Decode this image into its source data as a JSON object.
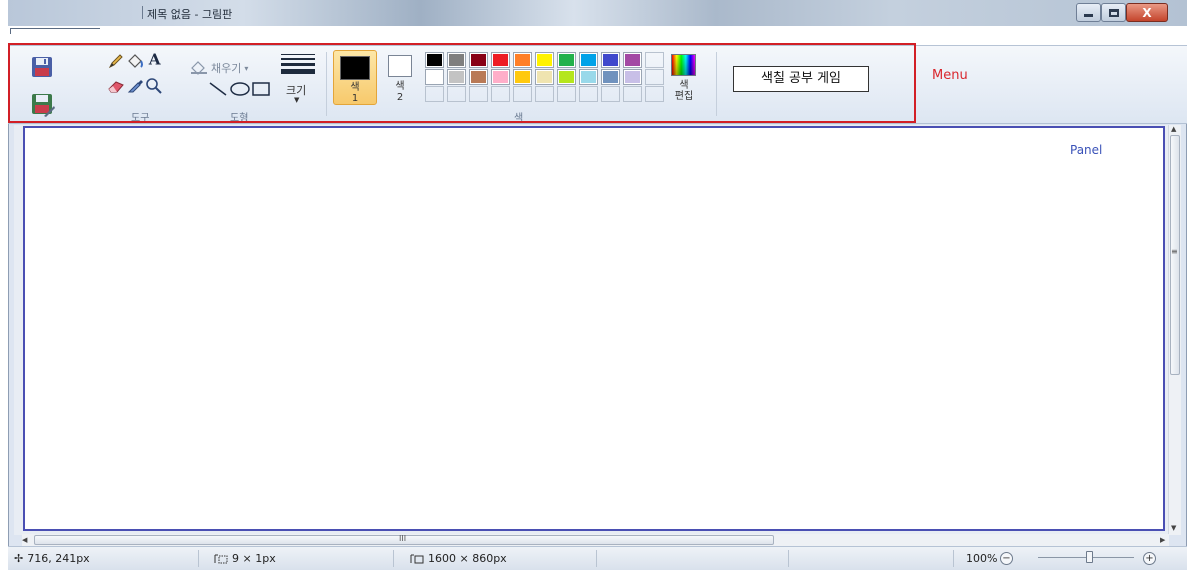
{
  "window": {
    "title": "제목 없음 - 그림판",
    "buttons": {
      "minimize": "minimize",
      "maximize": "maximize",
      "close": "X"
    }
  },
  "ribbon": {
    "groups": {
      "tools": "도구",
      "shapes": "도형",
      "colors": "색"
    },
    "fill_label": "채우기",
    "size_label": "크기",
    "color1": {
      "line1": "색",
      "line2": "1",
      "value": "#000000"
    },
    "color2": {
      "line1": "색",
      "line2": "2",
      "value": "#ffffff"
    },
    "edit_colors": {
      "line1": "색",
      "line2": "편집"
    },
    "palette": [
      "#000000",
      "#7f7f7f",
      "#880015",
      "#ed1c24",
      "#ff7f27",
      "#fff200",
      "#22b14c",
      "#00a2e8",
      "#3f48cc",
      "#a349a4",
      "#ffffff",
      "#c3c3c3",
      "#b97a57",
      "#ffaec9",
      "#ffc90e",
      "#efe4b0",
      "#b5e61d",
      "#99d9ea",
      "#7092be",
      "#c8bfe7"
    ],
    "game_button": "색칠 공부 게임"
  },
  "annotations": {
    "menu": "Menu",
    "panel": "Panel"
  },
  "status": {
    "cursor_pos": "716, 241px",
    "selection_size": "9 × 1px",
    "image_size": "1600 × 860px",
    "zoom": "100%"
  },
  "scroll": {
    "hscroll_label": "III",
    "vscroll_label": "≡"
  }
}
